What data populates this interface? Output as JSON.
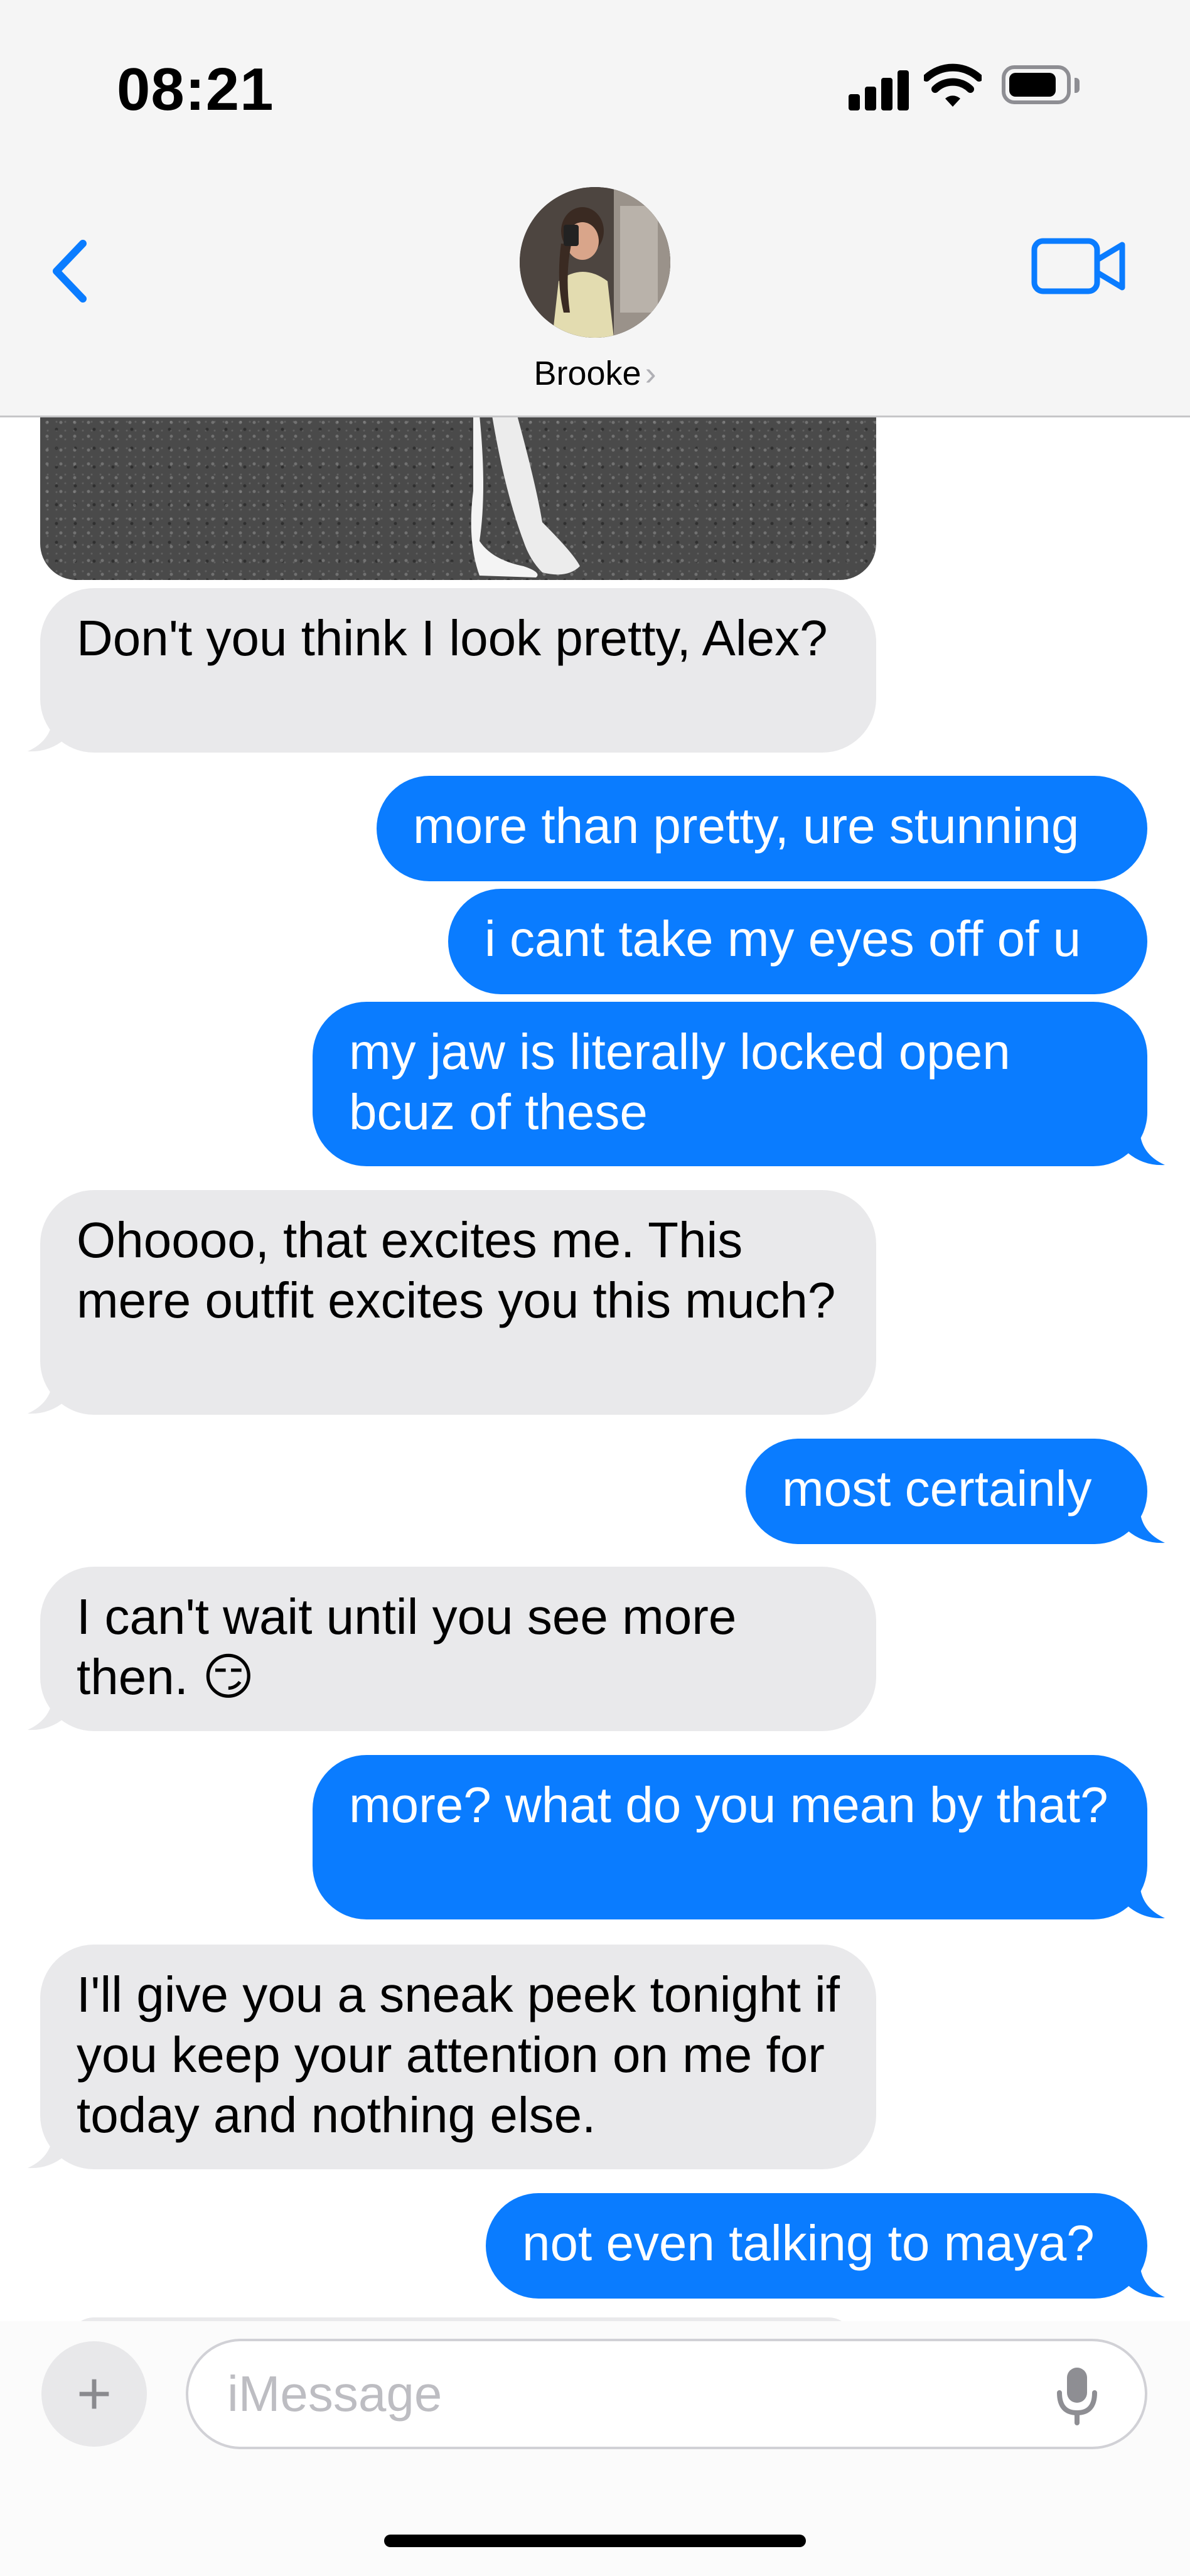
{
  "status_bar": {
    "time": "08:21"
  },
  "nav": {
    "contact_name": "Brooke",
    "chevron": "›"
  },
  "messages": [
    {
      "from": "them",
      "text": "Don't you think I look pretty, Alex?"
    },
    {
      "from": "me",
      "text": "more than pretty, ure stunning"
    },
    {
      "from": "me",
      "text": "i cant take my eyes off of u"
    },
    {
      "from": "me",
      "text": "my jaw is literally locked open bcuz of these"
    },
    {
      "from": "them",
      "text": "Ohoooo, that excites me. This mere outfit excites you this much?"
    },
    {
      "from": "me",
      "text": "most certainly"
    },
    {
      "from": "them",
      "text": "I can't wait until you see more then. 😏"
    },
    {
      "from": "me",
      "text": "more? what do you mean by that?"
    },
    {
      "from": "them",
      "text": "I'll give you a sneak peek tonight if you keep your attention on me for today and nothing else."
    },
    {
      "from": "me",
      "text": "not even talking to maya?"
    }
  ],
  "composer": {
    "placeholder": "iMessage",
    "plus_label": "+"
  },
  "icons": {
    "back": "chevron-left-icon",
    "video": "video-camera-icon",
    "mic": "microphone-icon",
    "signal": "cellular-signal-icon",
    "wifi": "wifi-icon",
    "battery": "battery-icon"
  },
  "colors": {
    "accent": "#0a7cff",
    "incoming_bubble": "#e9e9eb",
    "outgoing_bubble": "#0a7cff",
    "bar_background": "#f5f5f5"
  }
}
